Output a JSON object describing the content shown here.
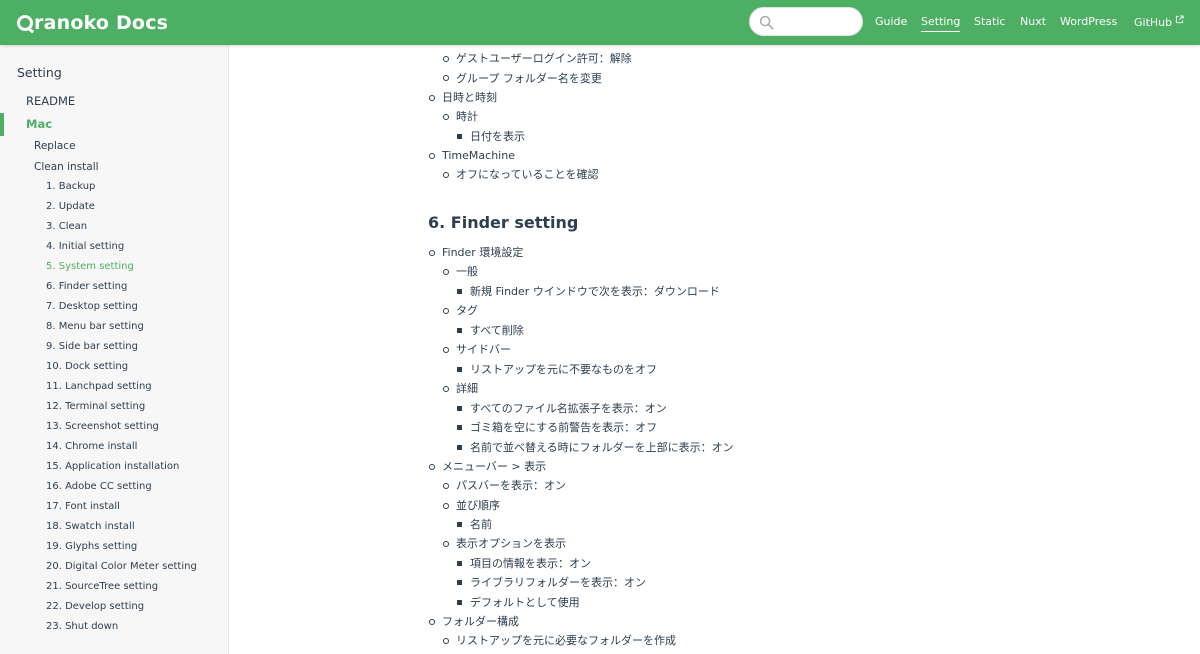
{
  "brand": {
    "name": "ranoko Docs"
  },
  "search": {
    "placeholder": ""
  },
  "nav": {
    "links": [
      {
        "label": "Guide"
      },
      {
        "label": "Setting"
      },
      {
        "label": "Static"
      },
      {
        "label": "Nuxt"
      },
      {
        "label": "WordPress"
      },
      {
        "label": "GitHub"
      }
    ]
  },
  "sidebar": {
    "heading": "Setting",
    "readme": "README",
    "mac": "Mac",
    "replace": "Replace",
    "clean_install": "Clean install",
    "steps": [
      "1. Backup",
      "2. Update",
      "3. Clean",
      "4. Initial setting",
      "5. System setting",
      "6. Finder setting",
      "7. Desktop setting",
      "8. Menu bar setting",
      "9. Side bar setting",
      "10. Dock setting",
      "11. Lanchpad setting",
      "12. Terminal setting",
      "13. Screenshot setting",
      "14. Chrome install",
      "15. Application installation",
      "16. Adobe CC setting",
      "17. Font install",
      "18. Swatch install",
      "19. Glyphs setting",
      "20. Digital Color Meter setting",
      "21. SourceTree setting",
      "22. Develop setting",
      "23. Shut down"
    ]
  },
  "content": {
    "top_items": [
      "ゲストユーザーログイン許可：解除",
      "グループ フォルダー名を変更",
      "日時と時刻",
      "時計",
      "日付を表示",
      "TimeMachine",
      "オフになっていることを確認"
    ],
    "section_title": "6. Finder setting",
    "finder_items": [
      "Finder 環境設定",
      "一般",
      "新規 Finder ウインドウで次を表示：ダウンロード",
      "タグ",
      "すべて削除",
      "サイドバー",
      "リストアップを元に不要なものをオフ",
      "詳細",
      "すべてのファイル名拡張子を表示：オン",
      "ゴミ箱を空にする前警告を表示：オフ",
      "名前で並べ替える時にフォルダーを上部に表示：オン",
      "メニューバー > 表示",
      "パスバーを表示：オン",
      "並び順序",
      "名前",
      "表示オプションを表示",
      "項目の情報を表示：オン",
      "ライブラリフォルダーを表示：オン",
      "デフォルトとして使用",
      "フォルダー構成",
      "リストアップを元に必要なフォルダーを作成"
    ]
  },
  "colors": {
    "accent": "#4caf63",
    "text": "#2c3e50",
    "sidebar_bg": "#f7f7f7"
  }
}
